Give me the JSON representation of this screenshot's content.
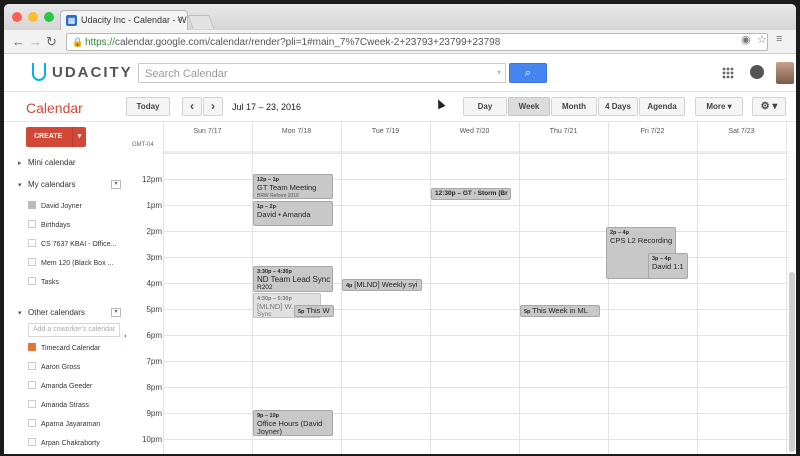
{
  "browser": {
    "tab_title": "Udacity Inc - Calendar - W",
    "tab_close": "×",
    "url_scheme": "https://",
    "url_rest": "calendar.google.com/calendar/render?pli=1#main_7%7Cweek-2+23793+23799+23798"
  },
  "header": {
    "logo_text": "UDACITY",
    "search_placeholder": "Search Calendar",
    "search_caret": "▾",
    "search_button_icon": "⌕"
  },
  "toolbar": {
    "title": "Calendar",
    "today": "Today",
    "prev": "‹",
    "next": "›",
    "date_range": "Jul 17 – 23, 2016",
    "views": [
      "Day",
      "Week",
      "Month",
      "4 Days",
      "Agenda"
    ],
    "active_view": "Week",
    "more": "More ▾",
    "settings": "⚙ ▾"
  },
  "sidebar": {
    "create": "CREATE",
    "create_caret": "▾",
    "mini_calendar": "Mini calendar",
    "my_calendars": "My calendars",
    "my_calendar_items": [
      "David Joyner",
      "Birthdays",
      "CS 7637 KBAI - Office...",
      "Mem 120 (Black Box ...",
      "Tasks"
    ],
    "other_calendars": "Other calendars",
    "add_coworker_placeholder": "Add a coworker's calendar",
    "other_calendar_items": [
      "Timecard Calendar",
      "Aaron Gross",
      "Amanda Geeder",
      "Amanda Strass",
      "Aparna Jayaraman",
      "Arpan Chakraborty"
    ],
    "collapse_arrow": "▸",
    "expand_arrow": "▾",
    "dropdown": "▾"
  },
  "grid": {
    "timezone": "GMT-04",
    "days": [
      "Sun 7/17",
      "Mon 7/18",
      "Tue 7/19",
      "Wed 7/20",
      "Thu 7/21",
      "Fri 7/22",
      "Sat 7/23"
    ],
    "hours": [
      "12pm",
      "1pm",
      "2pm",
      "3pm",
      "4pm",
      "5pm",
      "6pm",
      "7pm",
      "8pm",
      "9pm",
      "10pm"
    ]
  },
  "events": {
    "gt_team": {
      "time": "12p – 1p",
      "title": "GT Team Meeting",
      "sub": "BRW Reform 2016"
    },
    "david_amanda": {
      "time": "1p – 2p",
      "title": "David • Amanda"
    },
    "nd_team": {
      "time": "3:30p – 4:30p",
      "title": "ND Team Lead Sync",
      "sub": "R202"
    },
    "mlnd_weekly": {
      "time": "4p",
      "title": "[MLND] Weekly syi"
    },
    "mlnd_faint": {
      "time": "4:30p – 5:30p",
      "title": "[MLND] W...",
      "sub": "Sync"
    },
    "this_week_mon": {
      "time": "5p",
      "title": "This W"
    },
    "gt_storm": {
      "time": "12:30p – GT - Storm (Br"
    },
    "this_week_thu": {
      "time": "5p",
      "title": "This Week in ML"
    },
    "cps_recording": {
      "time": "2p – 4p",
      "title": "CPS L2 Recording"
    },
    "david_11": {
      "time": "3p – 4p",
      "title": "David 1:1"
    },
    "office_hours": {
      "time": "9p – 10p",
      "title": "Office Hours (David",
      "sub": "Joyner)"
    }
  },
  "colors": {
    "brand_red": "#d14836",
    "search_blue": "#4585f2",
    "event_grey": "#c8c8c8",
    "timecard_chip": "#e8733b"
  }
}
